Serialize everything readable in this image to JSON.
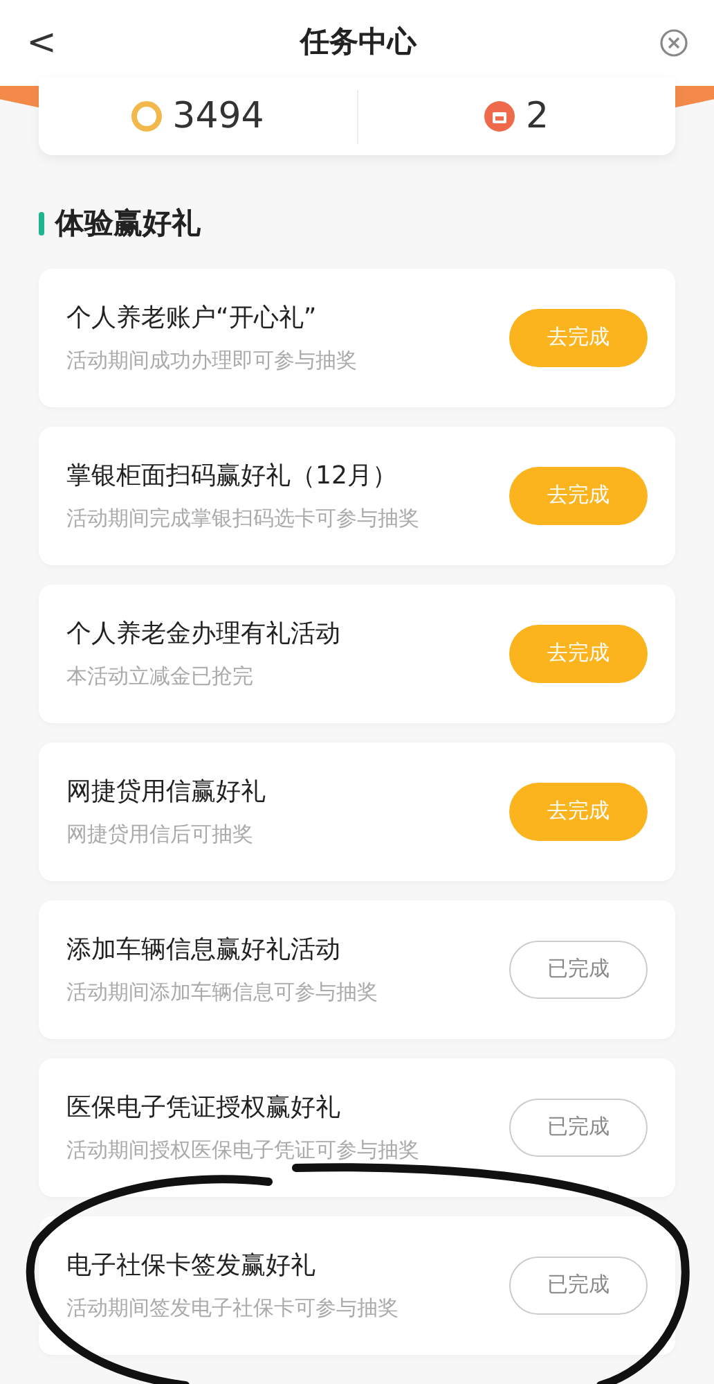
{
  "header": {
    "back": "<",
    "title": "任务中心"
  },
  "stats": [
    {
      "kind": "coin",
      "value": "3494"
    },
    {
      "kind": "ticket",
      "value": "2"
    }
  ],
  "section": {
    "title": "体验赢好礼"
  },
  "tasks": [
    {
      "title": "个人养老账户“开心礼”",
      "subtitle": "活动期间成功办理即可参与抽奖",
      "button": "去完成",
      "done": false
    },
    {
      "title": "掌银柜面扫码赢好礼（12月）",
      "subtitle": "活动期间完成掌银扫码选卡可参与抽奖",
      "button": "去完成",
      "done": false
    },
    {
      "title": "个人养老金办理有礼活动",
      "subtitle": "本活动立减金已抢完",
      "button": "去完成",
      "done": false
    },
    {
      "title": "网捷贷用信赢好礼",
      "subtitle": "网捷贷用信后可抽奖",
      "button": "去完成",
      "done": false
    },
    {
      "title": "添加车辆信息赢好礼活动",
      "subtitle": "活动期间添加车辆信息可参与抽奖",
      "button": "已完成",
      "done": true
    },
    {
      "title": "医保电子凭证授权赢好礼",
      "subtitle": "活动期间授权医保电子凭证可参与抽奖",
      "button": "已完成",
      "done": true
    },
    {
      "title": "电子社保卡签发赢好礼",
      "subtitle": "活动期间签发电子社保卡可参与抽奖",
      "button": "已完成",
      "done": true
    }
  ]
}
